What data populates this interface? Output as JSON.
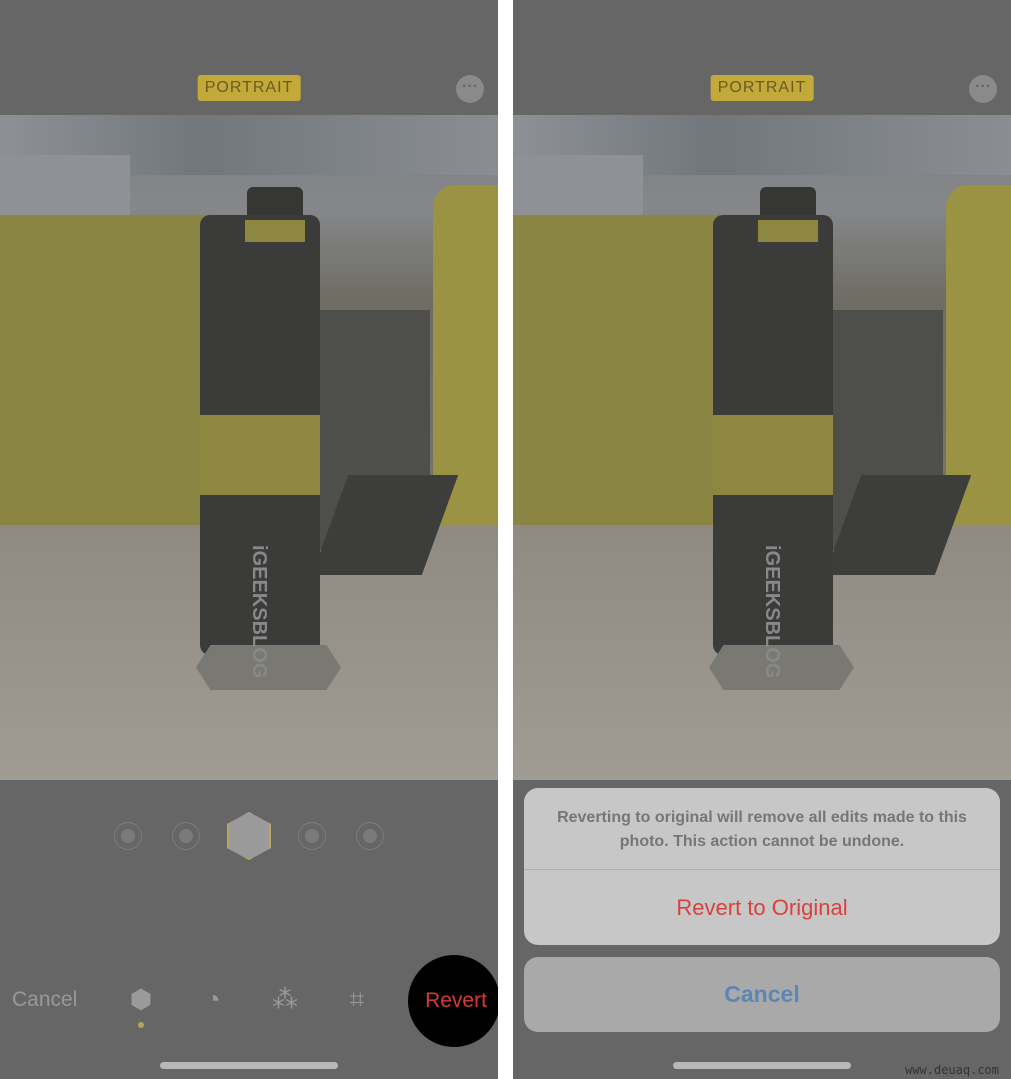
{
  "left_screen": {
    "mode_badge": "PORTRAIT",
    "more_icon": "ellipsis-circle-icon",
    "photo_logo": "iGEEKSBLOG",
    "lighting_options": [
      "natural-light",
      "studio-light",
      "contour-light",
      "stage-light",
      "stage-light-mono"
    ],
    "selected_lighting": "studio-light",
    "toolbar": {
      "cancel": "Cancel",
      "tools": [
        "portrait-cube-icon",
        "adjust-dial-icon",
        "filters-icon",
        "crop-rotate-icon"
      ],
      "revert": "Revert"
    }
  },
  "right_screen": {
    "mode_badge": "PORTRAIT",
    "photo_logo": "iGEEKSBLOG",
    "sheet": {
      "message": "Reverting to original will remove all edits made to this photo. This action cannot be undone.",
      "destructive": "Revert to Original",
      "cancel": "Cancel"
    }
  },
  "watermark": "www.deuaq.com",
  "colors": {
    "badge": "#c2a93a",
    "destructive": "#d9413b",
    "cancel": "#5b86b8",
    "highlight": "#000000"
  }
}
